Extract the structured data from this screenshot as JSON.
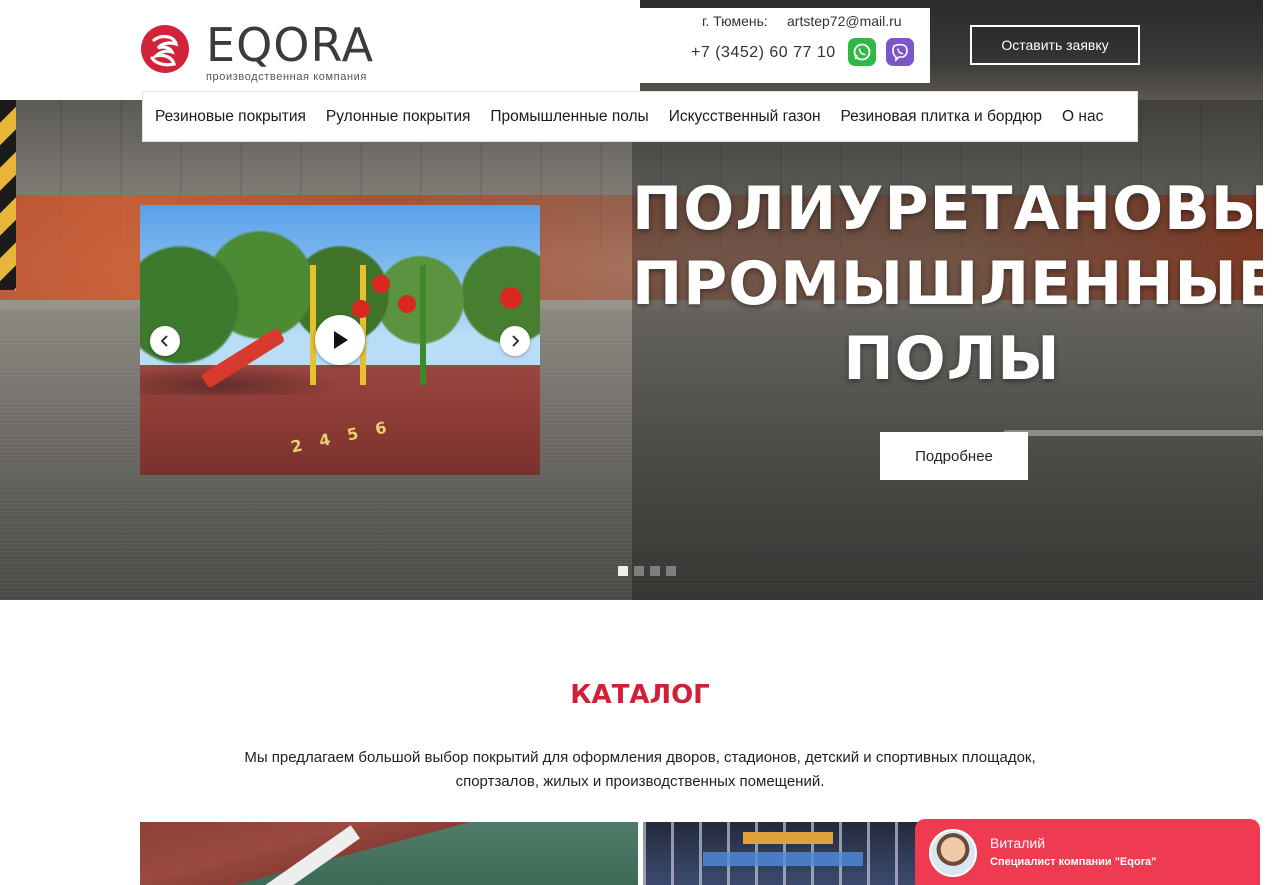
{
  "header": {
    "logo_text": "EQORA",
    "logo_subtitle": "производственная компания",
    "city": "г. Тюмень:",
    "email": "artstep72@mail.ru",
    "phone": "+7 (3452) 60 77 10",
    "cta_label": "Оставить заявку"
  },
  "menu": {
    "items": [
      {
        "label": "Резиновые покрытия"
      },
      {
        "label": "Рулонные покрытия"
      },
      {
        "label": "Промышленные полы"
      },
      {
        "label": "Искусственный газон"
      },
      {
        "label": "Резиновая плитка и бордюр"
      },
      {
        "label": "О нас"
      }
    ]
  },
  "hero": {
    "title_lines": [
      "ПОЛИУРЕТАНОВЫЕ",
      "ПРОМЫШЛЕННЫЕ",
      "ПОЛЫ"
    ],
    "button_label": "Подробнее",
    "slides_count": 4,
    "active_slide": 1,
    "video_numbers": "2 4 5 6"
  },
  "catalog": {
    "title": "КАТАЛОГ",
    "description": "Мы предлагаем большой выбор покрытий для оформления дворов, стадионов, детский и спортивных площадок, спортзалов, жилых и производственных помещений."
  },
  "chat": {
    "name": "Виталий",
    "role": "Специалист компании \"Eqora\""
  },
  "icons": {
    "whatsapp": "whatsapp-icon",
    "viber": "viber-icon",
    "play": "play-icon",
    "prev": "chevron-left-icon",
    "next": "chevron-right-icon"
  },
  "colors": {
    "accent": "#d21f36",
    "chat_bg": "#ee3b52",
    "whatsapp": "#2fb845",
    "viber": "#7c55c6",
    "logo_mark": "#d2233a"
  }
}
